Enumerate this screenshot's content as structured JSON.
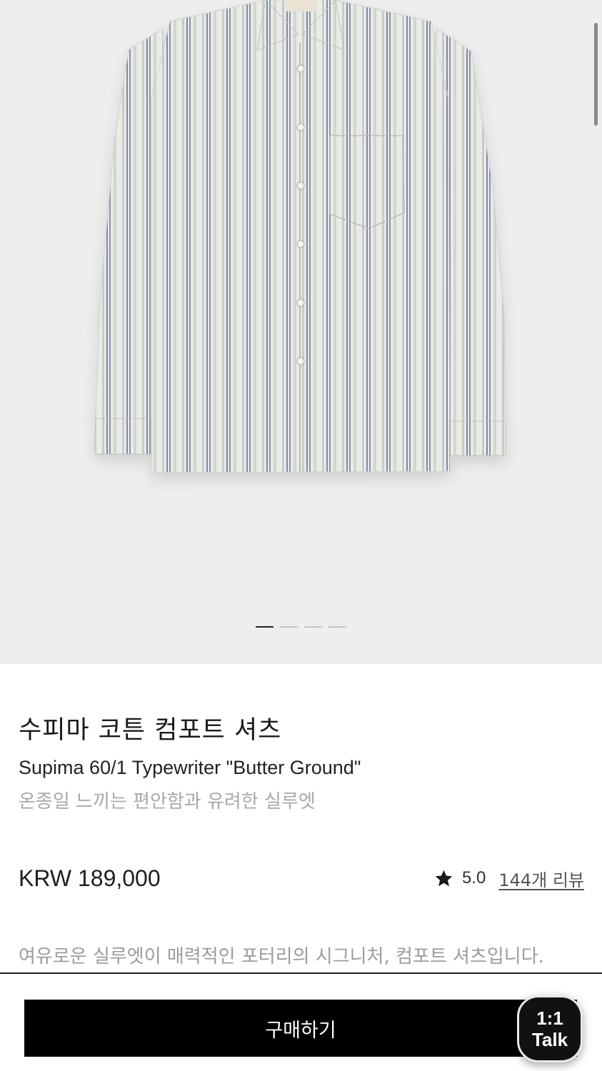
{
  "product": {
    "name_ko": "수피마 코튼 컴포트 셔츠",
    "name_en": "Supima 60/1 Typewriter \"Butter Ground\"",
    "subtitle": "온종일 느끼는 편안함과 유려한 실루엣",
    "price": "KRW 189,000",
    "rating": "5.0",
    "review_link": "144개 리뷰",
    "description": "여유로운 실루엣이 매력적인 포터리의 시그니처, 컴포트 셔츠입니다."
  },
  "gallery": {
    "image_count": 4,
    "active_index": 0,
    "icon": "striped-shirt-photo"
  },
  "actions": {
    "buy_label": "구매하기",
    "talk_line1": "1:1",
    "talk_line2": "Talk"
  },
  "colors": {
    "hero_bg": "#eeeeee",
    "button_bg": "#000000",
    "muted_text": "#a8a8a8"
  }
}
